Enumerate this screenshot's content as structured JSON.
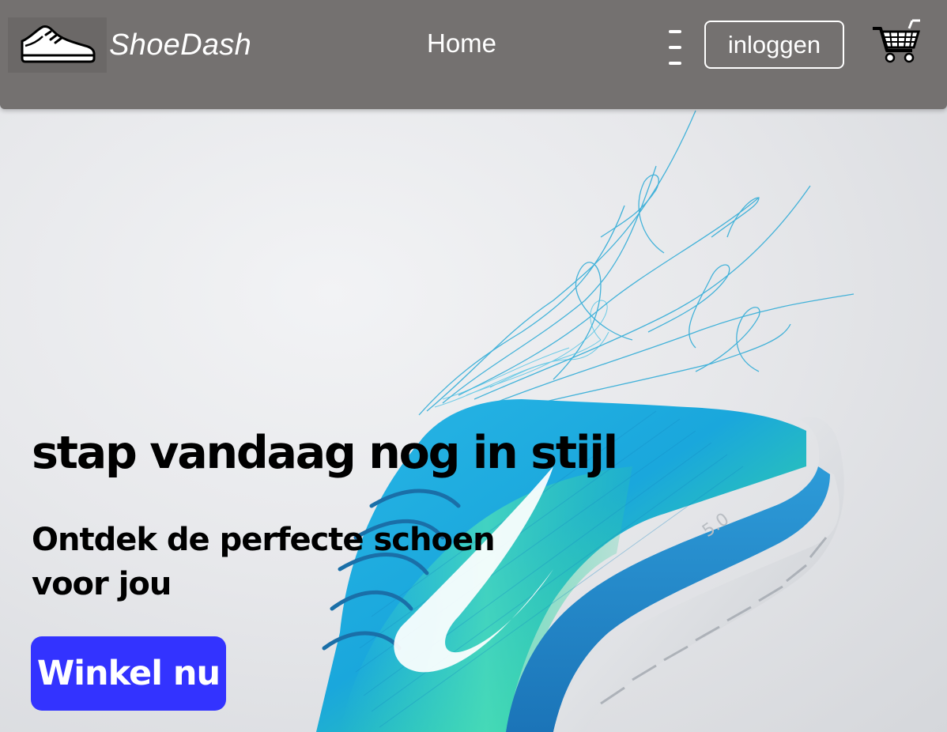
{
  "nav": {
    "brand_name": "ShoeDash",
    "logo_icon": "sneaker-icon",
    "home_label": "Home",
    "menu_icon": "hamburger-menu-icon",
    "login_label": "inloggen",
    "cart_icon": "shopping-cart-icon",
    "background_color": "#747170"
  },
  "hero": {
    "headline": "stap vandaag nog in stijl",
    "subheadline": "Ontdek de perfecte schoen voor jou",
    "cta_label": "Winkel nu",
    "cta_color": "#3333ff",
    "image_icon": "running-shoe-image"
  }
}
